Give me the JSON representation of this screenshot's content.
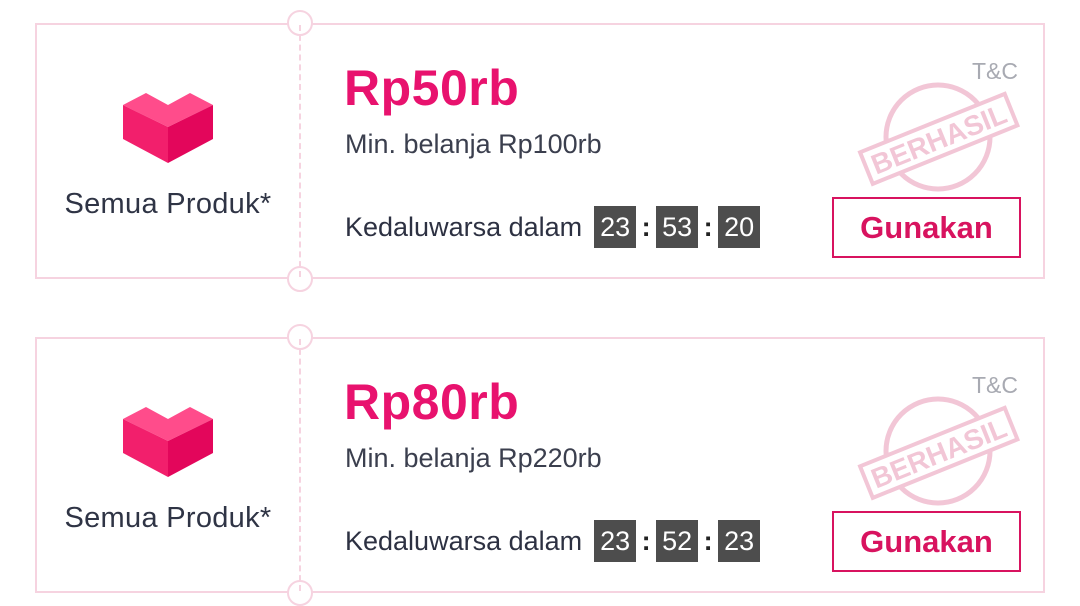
{
  "colors": {
    "accent": "#e8126e",
    "button": "#d8135f",
    "border": "#f6d3e0",
    "timer_bg": "#4d4d4d",
    "stamp": "#f2c6d6"
  },
  "vouchers": [
    {
      "category": "Semua Produk*",
      "amount": "Rp50rb",
      "min_spend": "Min. belanja Rp100rb",
      "expiry_label": "Kedaluwarsa dalam",
      "timer": {
        "hours": "23",
        "minutes": "53",
        "seconds": "20"
      },
      "tc": "T&C",
      "stamp_text": "BERHASIL",
      "button": "Gunakan",
      "icon": "heart-box-icon"
    },
    {
      "category": "Semua Produk*",
      "amount": "Rp80rb",
      "min_spend": "Min. belanja Rp220rb",
      "expiry_label": "Kedaluwarsa dalam",
      "timer": {
        "hours": "23",
        "minutes": "52",
        "seconds": "23"
      },
      "tc": "T&C",
      "stamp_text": "BERHASIL",
      "button": "Gunakan",
      "icon": "heart-box-icon"
    }
  ]
}
